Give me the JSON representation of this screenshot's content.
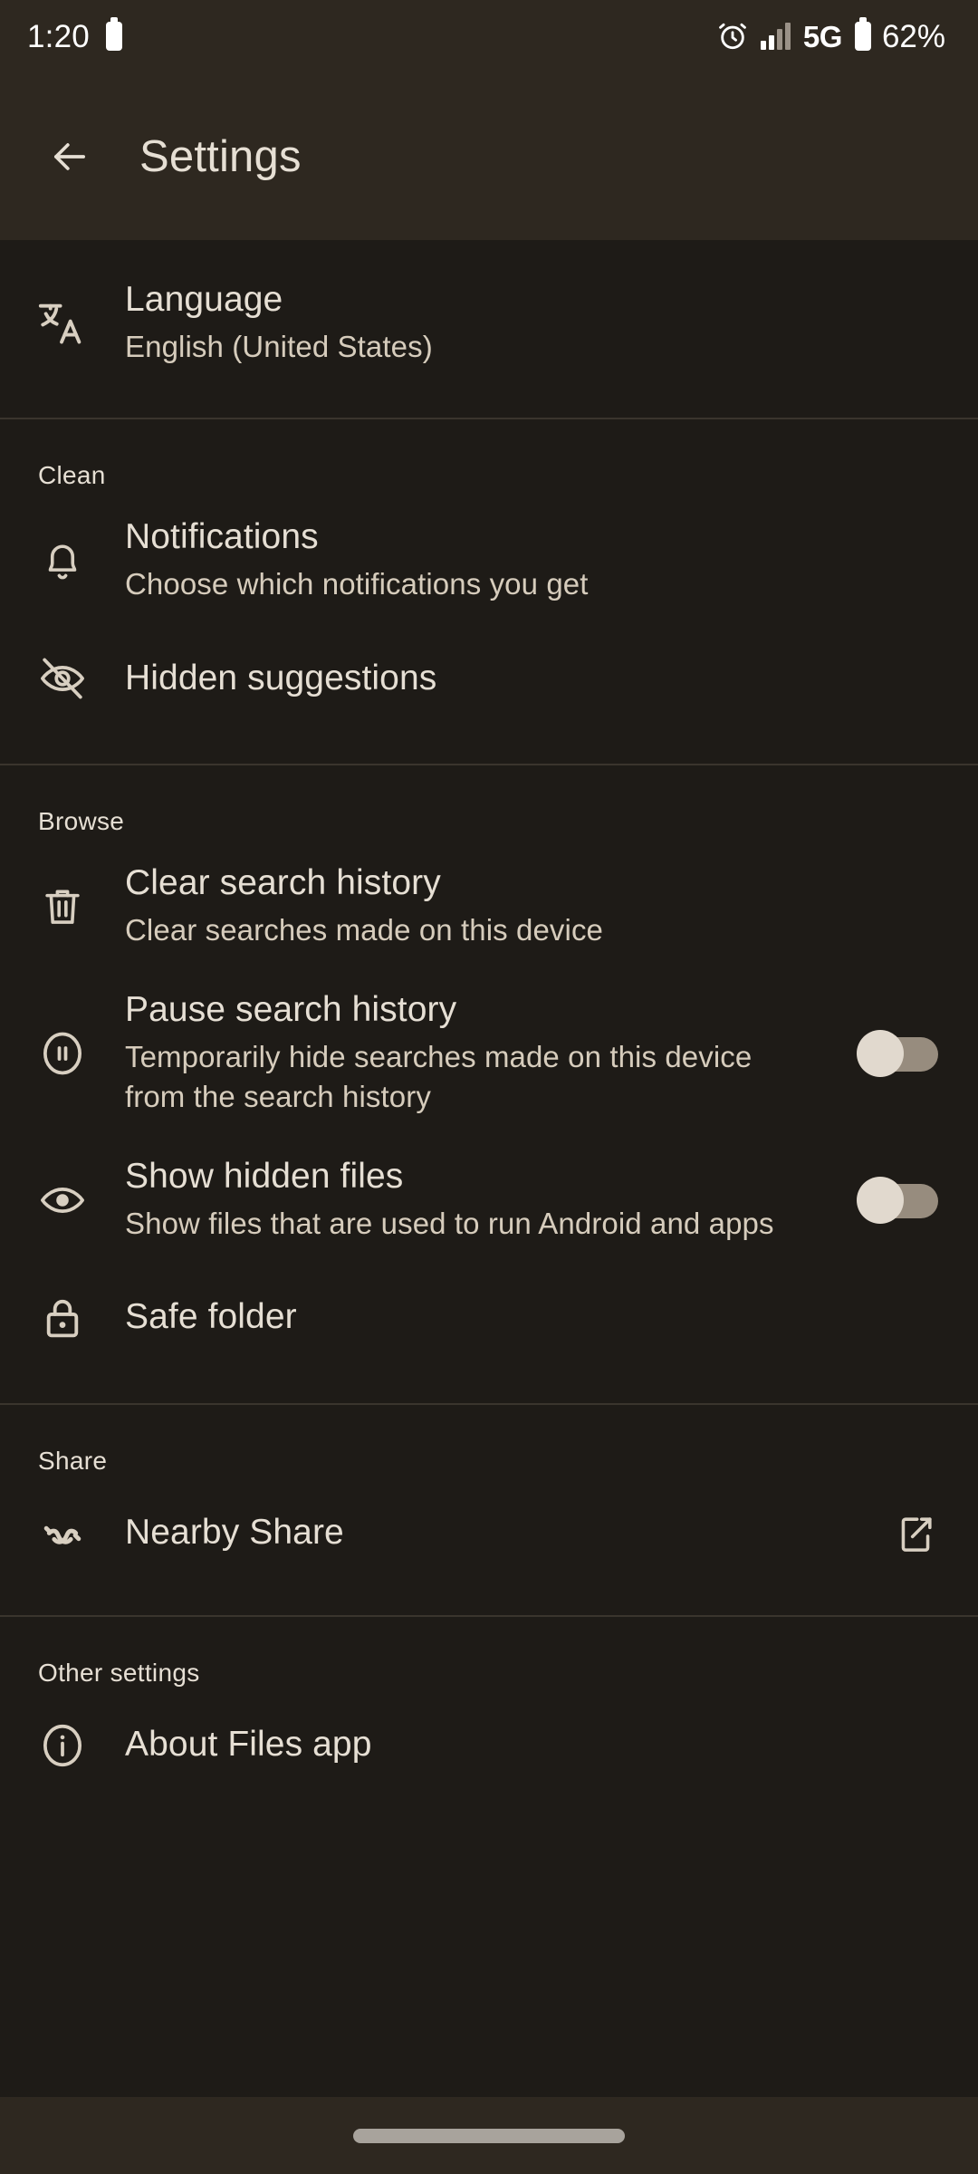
{
  "status_bar": {
    "time": "1:20",
    "battery_icon": "battery-icon",
    "alarm_icon": "alarm-icon",
    "signal_icon": "signal-bars-icon",
    "network": "5G",
    "battery_percent": "62%"
  },
  "app_bar": {
    "back_icon": "back-arrow-icon",
    "title": "Settings"
  },
  "colors": {
    "app_bar_bg": "#2E2820",
    "body_bg": "#1E1B17",
    "divider": "#3A352D",
    "primary_text": "#E6DFD4",
    "secondary_text": "#D6CCBC",
    "switch_track_off": "#978C7E",
    "switch_knob": "#E1D9CE",
    "nav_pill": "#A8A39C"
  },
  "sections": [
    {
      "header": null,
      "rows": [
        {
          "icon": "translate-icon",
          "title": "Language",
          "subtitle": "English (United States)",
          "trailing": null
        }
      ]
    },
    {
      "header": "Clean",
      "rows": [
        {
          "icon": "bell-icon",
          "title": "Notifications",
          "subtitle": "Choose which notifications you get",
          "trailing": null
        },
        {
          "icon": "eye-off-icon",
          "title": "Hidden suggestions",
          "subtitle": null,
          "trailing": null
        }
      ]
    },
    {
      "header": "Browse",
      "rows": [
        {
          "icon": "trash-icon",
          "title": "Clear search history",
          "subtitle": "Clear searches made on this device",
          "trailing": null
        },
        {
          "icon": "pause-circle-icon",
          "title": "Pause search history",
          "subtitle": "Temporarily hide searches made on this device from the search history",
          "trailing": "switch-off"
        },
        {
          "icon": "eye-icon",
          "title": "Show hidden files",
          "subtitle": "Show files that are used to run Android and apps",
          "trailing": "switch-off"
        },
        {
          "icon": "lock-icon",
          "title": "Safe folder",
          "subtitle": null,
          "trailing": null
        }
      ]
    },
    {
      "header": "Share",
      "rows": [
        {
          "icon": "nearby-share-icon",
          "title": "Nearby Share",
          "subtitle": null,
          "trailing": "open-in-new-icon"
        }
      ]
    },
    {
      "header": "Other settings",
      "rows": [
        {
          "icon": "info-icon",
          "title": "About Files app",
          "subtitle": null,
          "trailing": null
        }
      ]
    }
  ],
  "nav_bar": {
    "home_pill": "home-gesture-pill"
  }
}
